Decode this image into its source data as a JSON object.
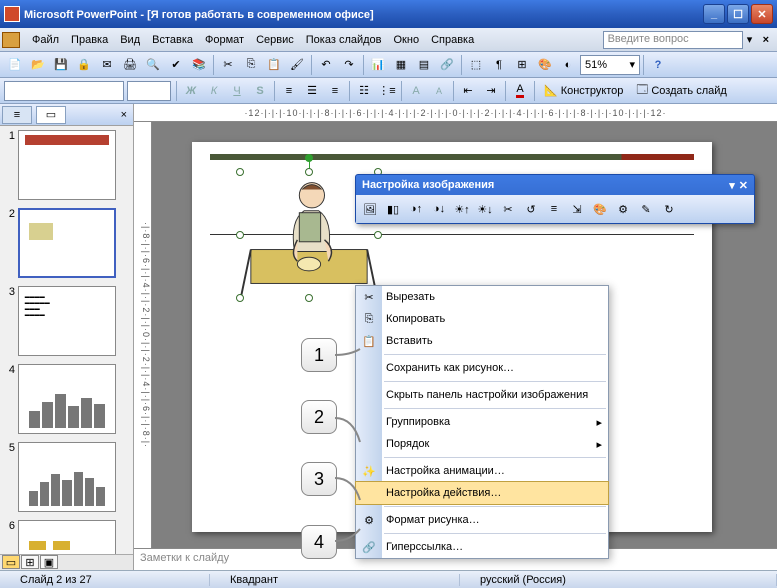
{
  "titlebar": {
    "app": "Microsoft PowerPoint",
    "doc": "[Я готов работать в современном офисе]"
  },
  "menu": {
    "file": "Файл",
    "edit": "Правка",
    "view": "Вид",
    "insert": "Вставка",
    "format": "Формат",
    "tools": "Сервис",
    "slideshow": "Показ слайдов",
    "window": "Окно",
    "help": "Справка",
    "ask": "Введите вопрос"
  },
  "zoom": "51%",
  "designer_btn": "Конструктор",
  "new_slide_btn": "Создать слайд",
  "pic_toolbar_title": "Настройка изображения",
  "ctx": {
    "cut": "Вырезать",
    "copy": "Копировать",
    "paste": "Вставить",
    "save_as_pic": "Сохранить как рисунок…",
    "hide_pic_tb": "Скрыть панель настройки изображения",
    "group": "Группировка",
    "order": "Порядок",
    "anim": "Настройка анимации…",
    "action": "Настройка действия…",
    "format": "Формат рисунка…",
    "hyperlink": "Гиперссылка…"
  },
  "callouts": {
    "c1": "1",
    "c2": "2",
    "c3": "3",
    "c4": "4"
  },
  "notes_placeholder": "Заметки к слайду",
  "status": {
    "slide": "Слайд 2 из 27",
    "layout": "Квадрант",
    "lang": "русский (Россия)"
  },
  "ruler_h": "·12·|·|·|·10·|·|·|·8·|·|·|·6·|·|·|·4·|·|·|·2·|·|·|·0·|·|·|·2·|·|·|·4·|·|·|·6·|·|·|·8·|·|·|·10·|·|·|·12·",
  "ruler_v": "·|·8·|·|·6·|·|·4·|·|·2·|·|·0·|·|·2·|·|·4·|·|·6·|·|·8·|·"
}
